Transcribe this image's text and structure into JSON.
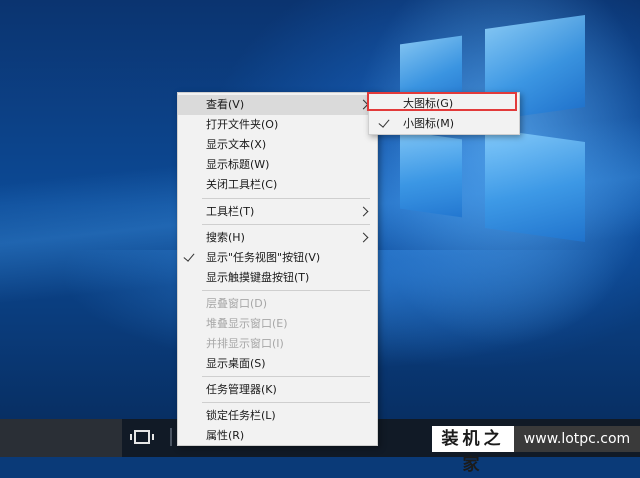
{
  "context_menu": {
    "items": [
      {
        "label": "查看(V)"
      },
      {
        "label": "打开文件夹(O)"
      },
      {
        "label": "显示文本(X)"
      },
      {
        "label": "显示标题(W)"
      },
      {
        "label": "关闭工具栏(C)"
      },
      {
        "label": "工具栏(T)"
      },
      {
        "label": "搜索(H)"
      },
      {
        "label": "显示\"任务视图\"按钮(V)"
      },
      {
        "label": "显示触摸键盘按钮(T)"
      },
      {
        "label": "层叠窗口(D)"
      },
      {
        "label": "堆叠显示窗口(E)"
      },
      {
        "label": "并排显示窗口(I)"
      },
      {
        "label": "显示桌面(S)"
      },
      {
        "label": "任务管理器(K)"
      },
      {
        "label": "锁定任务栏(L)"
      },
      {
        "label": "属性(R)"
      }
    ]
  },
  "submenu": {
    "items": [
      {
        "label": "大图标(G)"
      },
      {
        "label": "小图标(M)"
      }
    ]
  },
  "watermark": {
    "site_name": "装机之家",
    "url": "www.lotpc.com"
  },
  "colors": {
    "highlight_border": "#e23a3a",
    "menu_background": "#f2f2f2",
    "taskbar": "#111a26"
  }
}
